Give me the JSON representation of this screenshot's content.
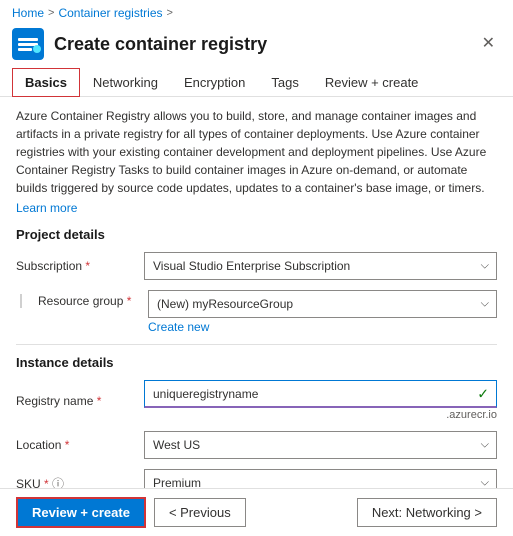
{
  "breadcrumb": {
    "home": "Home",
    "separator1": ">",
    "current": "Container registries",
    "separator2": ">"
  },
  "header": {
    "title": "Create container registry",
    "close_icon": "✕"
  },
  "tabs": [
    {
      "label": "Basics",
      "active": true
    },
    {
      "label": "Networking",
      "active": false
    },
    {
      "label": "Encryption",
      "active": false
    },
    {
      "label": "Tags",
      "active": false
    },
    {
      "label": "Review + create",
      "active": false
    }
  ],
  "description": "Azure Container Registry allows you to build, store, and manage container images and artifacts in a private registry for all types of container deployments. Use Azure container registries with your existing container development and deployment pipelines. Use Azure Container Registry Tasks to build container images in Azure on-demand, or automate builds triggered by source code updates, updates to a container's base image, or timers.",
  "learn_more": "Learn more",
  "sections": {
    "project": {
      "title": "Project details",
      "subscription": {
        "label": "Subscription",
        "required": true,
        "value": "Visual Studio Enterprise Subscription"
      },
      "resource_group": {
        "label": "Resource group",
        "required": true,
        "value": "(New) myResourceGroup",
        "create_new": "Create new"
      }
    },
    "instance": {
      "title": "Instance details",
      "registry_name": {
        "label": "Registry name",
        "required": true,
        "value": "uniqueregistryname",
        "suffix": ".azurecr.io"
      },
      "location": {
        "label": "Location",
        "required": true,
        "value": "West US"
      },
      "sku": {
        "label": "SKU",
        "required": true,
        "value": "Premium"
      }
    }
  },
  "footer": {
    "review_create": "Review + create",
    "previous": "< Previous",
    "next": "Next: Networking >"
  }
}
